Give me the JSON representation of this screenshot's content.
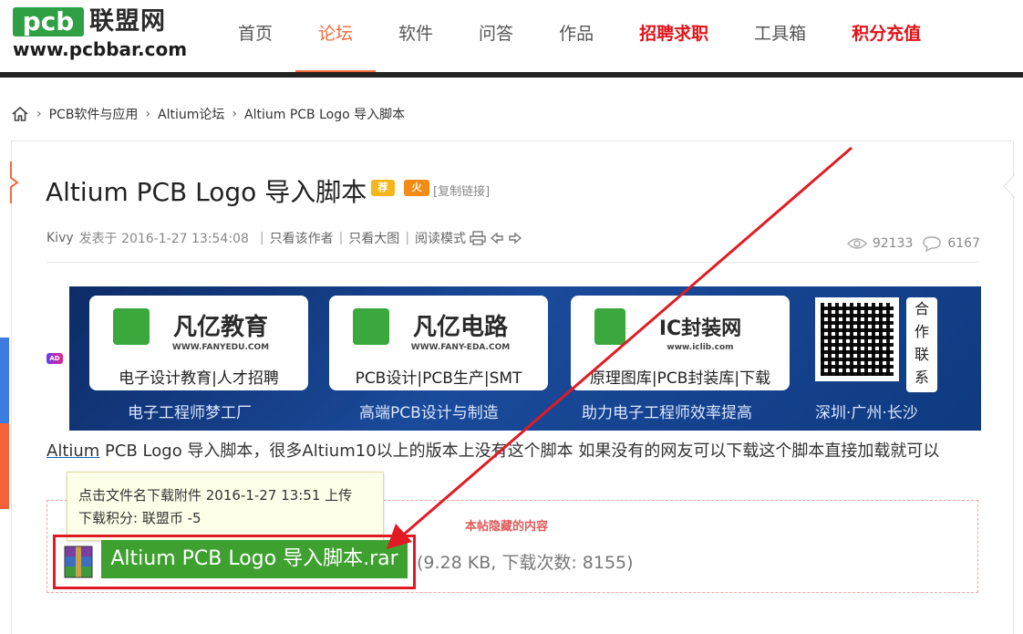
{
  "site": {
    "logo_mark": "pcb",
    "logo_name": "联盟网",
    "logo_url": "www.pcbbar.com"
  },
  "nav": [
    {
      "label": "首页",
      "state": "normal"
    },
    {
      "label": "论坛",
      "state": "active"
    },
    {
      "label": "软件",
      "state": "normal"
    },
    {
      "label": "问答",
      "state": "normal"
    },
    {
      "label": "作品",
      "state": "normal"
    },
    {
      "label": "招聘求职",
      "state": "highlight"
    },
    {
      "label": "工具箱",
      "state": "normal"
    },
    {
      "label": "积分充值",
      "state": "highlight"
    }
  ],
  "breadcrumb": [
    "PCB软件与应用",
    "Altium论坛",
    "Altium PCB Logo 导入脚本"
  ],
  "post": {
    "title": "Altium PCB Logo 导入脚本",
    "badge_recommend": "荐",
    "badge_hot": "火",
    "copy_link": "[复制链接]",
    "author": "Kivy",
    "posted": "发表于 2016-1-27 13:54:08",
    "only_author": "只看该作者",
    "only_big_image": "只看大图",
    "read_mode": "阅读模式",
    "views": "92133",
    "replies": "6167",
    "body_lead": "Altium",
    "body_rest": " PCB Logo 导入脚本，很多Altium10以上的版本上没有这个脚本  如果没有的网友可以下载这个脚本直接加载就可以"
  },
  "ad": {
    "tag": "AD",
    "boxes": [
      {
        "brand": "凡亿教育",
        "domain": "WWW.FANYEDU.COM",
        "sub": "电子设计教育|人才招聘",
        "caption": "电子工程师梦工厂"
      },
      {
        "brand": "凡亿电路",
        "domain": "WWW.FANY-EDA.COM",
        "sub": "PCB设计|PCB生产|SMT",
        "caption": "高端PCB设计与制造"
      },
      {
        "brand": "IC封装网",
        "domain": "www.iclib.com",
        "sub": "原理图库|PCB封装库|下载",
        "caption": "助力电子工程师效率提高"
      }
    ],
    "qr_side": [
      "合",
      "作",
      "联",
      "系"
    ],
    "qr_caption": "深圳·广州·长沙"
  },
  "attachment": {
    "hidden_label": "本帖隐藏的内容",
    "tooltip_line1": "点击文件名下载附件    2016-1-27 13:51 上传",
    "tooltip_line2": "下载积分: 联盟币 -5",
    "file_name": "Altium PCB Logo 导入脚本.rar",
    "file_info": "(9.28 KB, 下载次数: 8155)"
  },
  "colors": {
    "accent": "#f26b3a",
    "highlight_red": "#e0141a",
    "brand_green": "#2ea043",
    "download_green": "#3ea12f",
    "annotation_red": "#e01b24"
  }
}
